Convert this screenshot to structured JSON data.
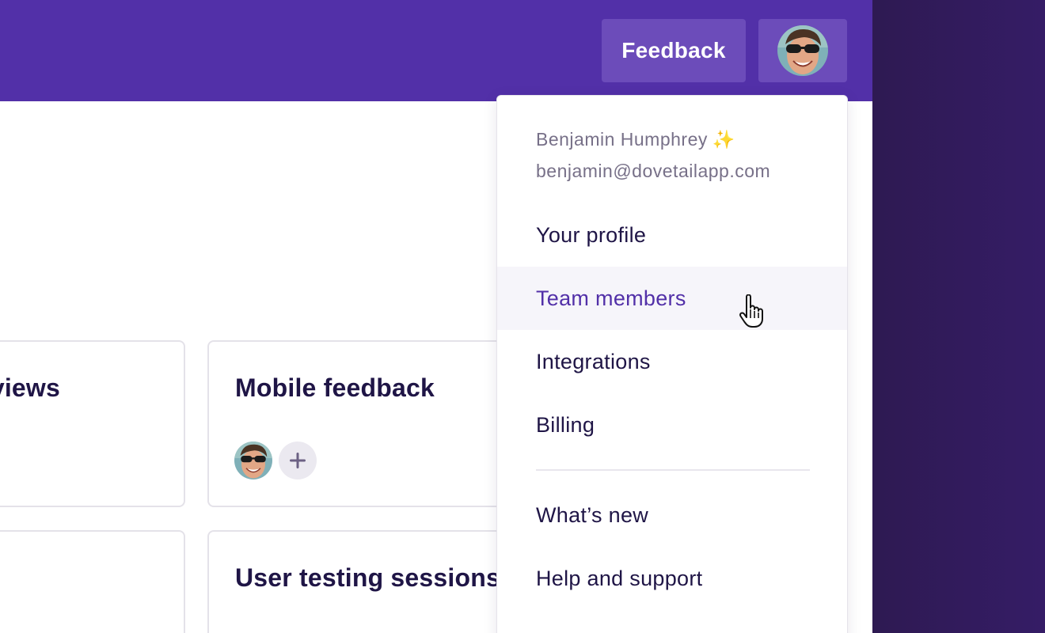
{
  "header": {
    "feedback_label": "Feedback",
    "avatar_alt": "user-avatar"
  },
  "projects": [
    {
      "title": "views"
    },
    {
      "title": "Mobile feedback"
    },
    {
      "title": ""
    },
    {
      "title": "User testing sessions"
    }
  ],
  "user_menu": {
    "name": "Benjamin Humphrey",
    "sparkle": "✨",
    "email": "benjamin@dovetailapp.com",
    "items": [
      {
        "label": "Your profile"
      },
      {
        "label": "Team members",
        "active": true
      },
      {
        "label": "Integrations"
      },
      {
        "label": "Billing"
      }
    ],
    "secondary_items": [
      {
        "label": "What’s new"
      },
      {
        "label": "Help and support"
      }
    ]
  },
  "colors": {
    "brand": "#5230a8",
    "brand_light": "#6c4cba",
    "text_dark": "#1f1546",
    "muted": "#777088"
  },
  "icons": {
    "add": "plus-icon",
    "cursor": "hand-pointer-icon"
  }
}
